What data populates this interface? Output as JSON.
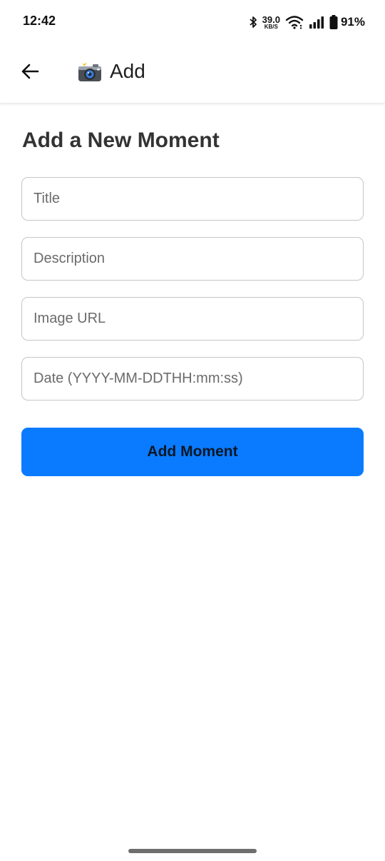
{
  "status_bar": {
    "time": "12:42",
    "net_speed_value": "39.0",
    "net_speed_unit": "KB/S",
    "battery_percent": "91%"
  },
  "app_bar": {
    "icon": "camera-flash-icon",
    "title": "Add"
  },
  "main": {
    "heading": "Add a New Moment",
    "fields": [
      {
        "placeholder": "Title",
        "value": ""
      },
      {
        "placeholder": "Description",
        "value": ""
      },
      {
        "placeholder": "Image URL",
        "value": ""
      },
      {
        "placeholder": "Date (YYYY-MM-DDTHH:mm:ss)",
        "value": ""
      }
    ],
    "submit_label": "Add Moment"
  },
  "colors": {
    "accent": "#0a7bff",
    "heading": "#333333",
    "field_border": "#c6c6c6"
  }
}
